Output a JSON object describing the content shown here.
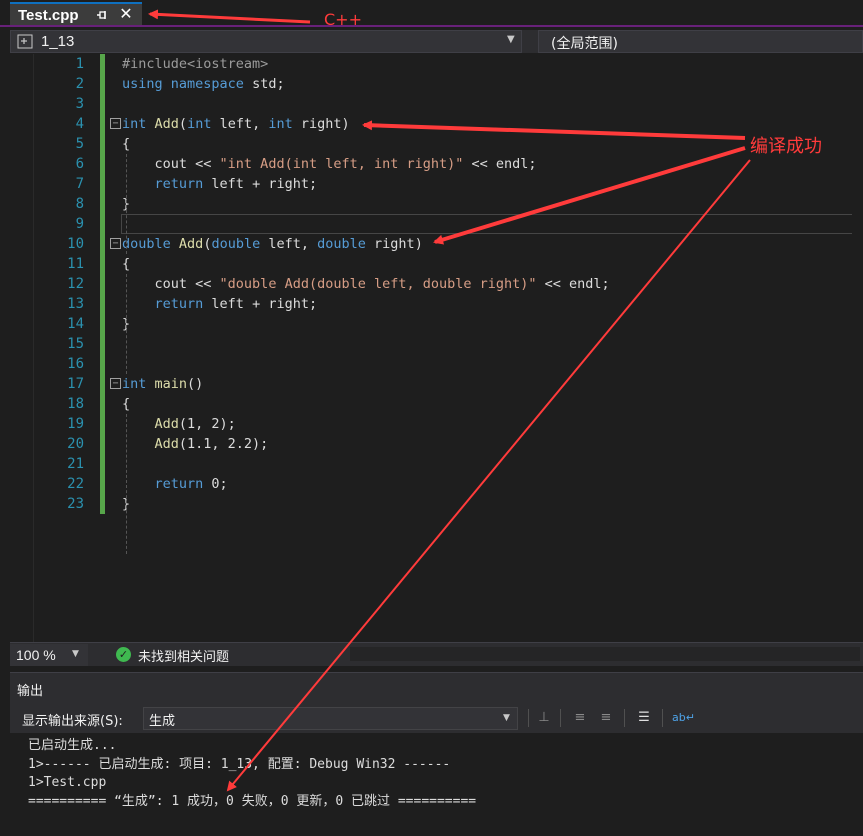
{
  "tab": {
    "title": "Test.cpp"
  },
  "navbar": {
    "scope": "1_13",
    "global_scope": "(全局范围)"
  },
  "editor": {
    "line_numbers": [
      "1",
      "2",
      "3",
      "4",
      "5",
      "6",
      "7",
      "8",
      "9",
      "10",
      "11",
      "12",
      "13",
      "14",
      "15",
      "16",
      "17",
      "18",
      "19",
      "20",
      "21",
      "22",
      "23"
    ]
  },
  "code": {
    "l1": "#include<iostream>",
    "l2_kw1": "using",
    "l2_kw2": "namespace",
    "l2_rest": " std;",
    "l4_kw": "int",
    "l4_fn": "Add",
    "l4_open": "(",
    "l4_kw2": "int",
    "l4_mid": " left, ",
    "l4_kw3": "int",
    "l4_close": " right)",
    "l5": "{",
    "l6_a": "cout << ",
    "l6_str": "\"int Add(int left, int right)\"",
    "l6_b": " << endl;",
    "l7_kw": "return",
    "l7_rest": " left + right;",
    "l8": "}",
    "l10_kw": "double",
    "l10_fn": "Add",
    "l10_open": "(",
    "l10_kw2": "double",
    "l10_mid": " left, ",
    "l10_kw3": "double",
    "l10_close": " right)",
    "l11": "{",
    "l12_a": "cout << ",
    "l12_str": "\"double Add(double left, double right)\"",
    "l12_b": " << endl;",
    "l13_kw": "return",
    "l13_rest": " left + right;",
    "l14": "}",
    "l17_kw": "int",
    "l17_fn": "main",
    "l17_rest": "()",
    "l18": "{",
    "l19_fn": "Add",
    "l19_rest": "(1, 2);",
    "l20_fn": "Add",
    "l20_rest": "(1.1, 2.2);",
    "l22_kw": "return",
    "l22_rest": " 0;",
    "l23": "}"
  },
  "statusbar": {
    "zoom": "100 %",
    "issues": "未找到相关问题"
  },
  "output": {
    "title": "输出",
    "source_label": "显示输出来源(S):",
    "source_value": "生成",
    "lines": [
      "已启动生成...",
      "1>------ 已启动生成: 项目: 1_13, 配置: Debug Win32 ------",
      "1>Test.cpp",
      "========== “生成”: 1 成功，0 失败，0 更新，0 已跳过 =========="
    ]
  },
  "annotations": {
    "cpp_label": "C++",
    "success_label": "编译成功",
    "color": "#ff3b3b"
  },
  "colors": {
    "keyword": "#569cd6",
    "function": "#dcdcaa",
    "string": "#d69d85",
    "line_number": "#2b91af",
    "change_bar": "#57a64a"
  }
}
